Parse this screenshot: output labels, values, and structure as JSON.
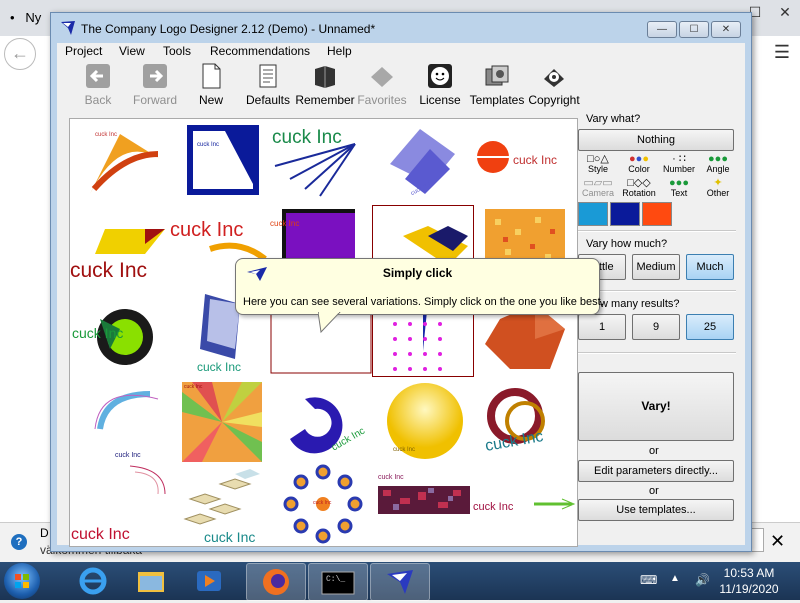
{
  "browser": {
    "tab_bullet": "•",
    "tab_title": "Ny",
    "min_glyph": "–",
    "max_glyph": "☐",
    "close_glyph": "✕",
    "back_glyph": "←",
    "menu_glyph": "☰",
    "infobar_line1": "D",
    "infobar_line2": "välkommen tillbaka",
    "infobar_close": "✕",
    "help_glyph": "?"
  },
  "app": {
    "title": "The Company Logo Designer 2.12 (Demo) - Unnamed*",
    "window_buttons": {
      "minimize": "—",
      "maximize": "☐",
      "close": "✕"
    },
    "menu": [
      "Project",
      "View",
      "Tools",
      "Recommendations",
      "Help"
    ],
    "toolbar": [
      {
        "label": "Back",
        "icon": "back-arrow-icon",
        "disabled": true
      },
      {
        "label": "Forward",
        "icon": "forward-arrow-icon",
        "disabled": true
      },
      {
        "label": "New",
        "icon": "new-page-icon",
        "disabled": false
      },
      {
        "label": "Defaults",
        "icon": "defaults-icon",
        "disabled": false
      },
      {
        "label": "Remember",
        "icon": "book-icon",
        "disabled": false
      },
      {
        "label": "Favorites",
        "icon": "favorites-icon",
        "disabled": true
      },
      {
        "label": "License",
        "icon": "smiley-icon",
        "disabled": false
      },
      {
        "label": "Templates",
        "icon": "templates-icon",
        "disabled": false
      },
      {
        "label": "Copyright",
        "icon": "copyright-icon",
        "disabled": false
      }
    ],
    "logo_text": "cuck Inc",
    "panel": {
      "vary_what": "Vary what?",
      "nothing": "Nothing",
      "vary_tabs": [
        "Style",
        "Color",
        "Number",
        "Angle",
        "Camera",
        "Rotation",
        "Text",
        "Other"
      ],
      "swatch_colors": [
        "#1a9ad6",
        "#0a1a9a",
        "#ff4a10"
      ],
      "vary_how_much": "Vary how much?",
      "amounts": [
        "Little",
        "Medium",
        "Much"
      ],
      "amount_selected": "Much",
      "how_many": "How many results?",
      "results": [
        "1",
        "9",
        "25"
      ],
      "results_selected": "25",
      "vary_button": "Vary!",
      "or1": "or",
      "edit_params": "Edit parameters directly...",
      "or2": "or",
      "use_templates": "Use templates..."
    },
    "tooltip": {
      "title": "Simply click",
      "body": "Here you can see several variations. Simply click on the one you like best."
    }
  },
  "taskbar": {
    "items": [
      "internet-explorer-icon",
      "file-explorer-icon",
      "media-player-icon",
      "firefox-icon",
      "command-prompt-icon",
      "logo-designer-icon"
    ],
    "active": "logo-designer-icon",
    "cmd_text": "C:\\_",
    "time": "10:53 AM",
    "date": "11/19/2020"
  }
}
